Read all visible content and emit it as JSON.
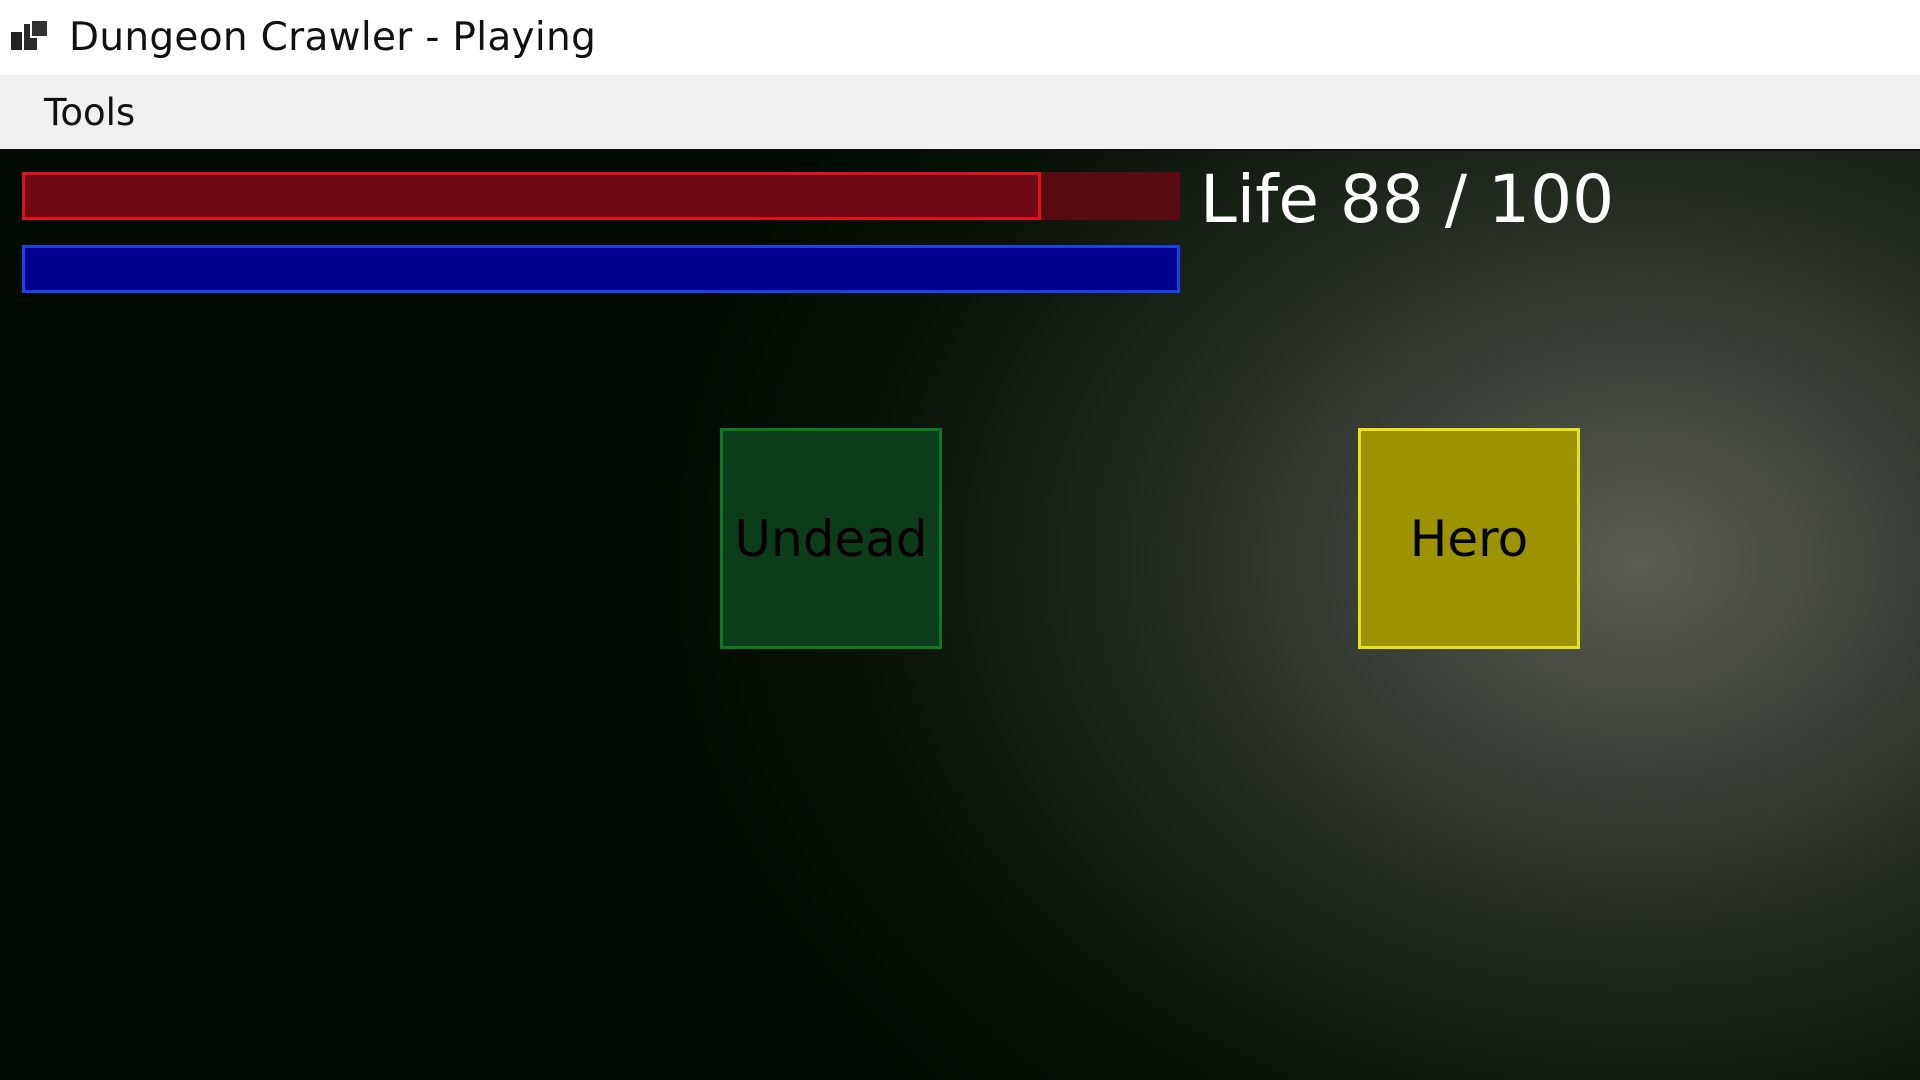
{
  "window": {
    "title": "Dungeon Crawler - Playing",
    "icon": "app-window-icon"
  },
  "menu": {
    "items": [
      {
        "label": "Tools"
      }
    ]
  },
  "hud": {
    "life": {
      "label": "Life 88 / 100",
      "current": 88,
      "max": 100,
      "fraction": 0.88,
      "fill_color": "#700a12",
      "border_color": "#e0111d",
      "track_color": "#5a0a12"
    },
    "mana": {
      "fraction": 1.0,
      "fill_color": "#000090",
      "border_color": "#1543e8"
    }
  },
  "entities": {
    "undead": {
      "label": "Undead",
      "color": "#0b3d1b"
    },
    "hero": {
      "label": "Hero",
      "color": "#9d9200"
    }
  }
}
